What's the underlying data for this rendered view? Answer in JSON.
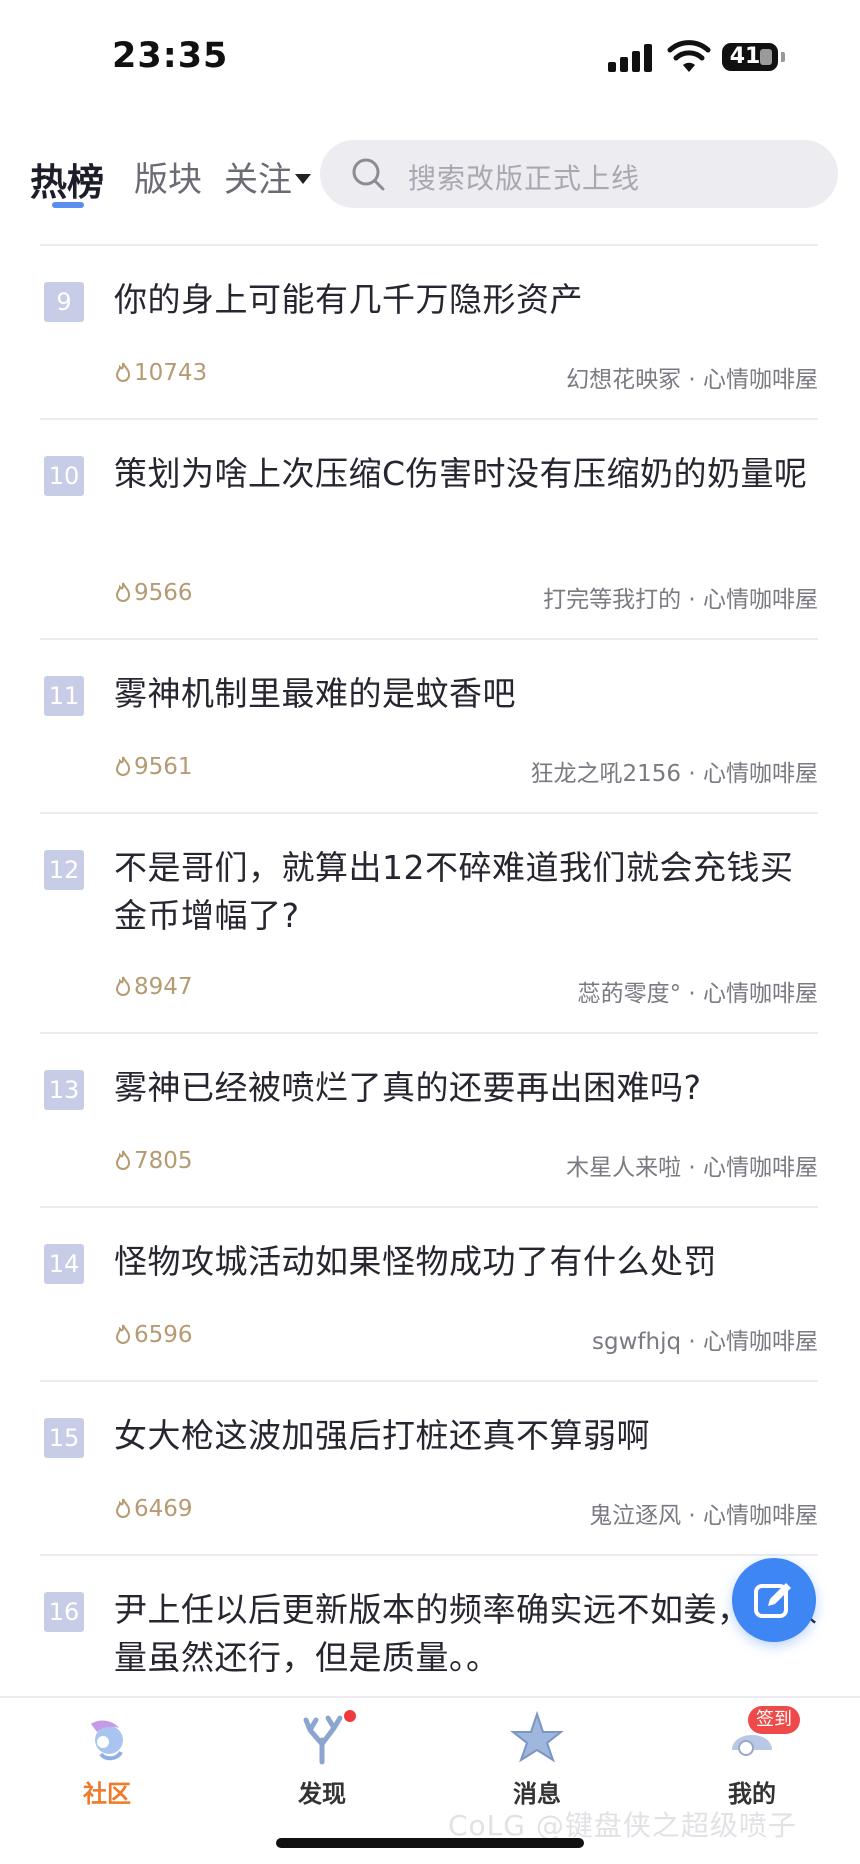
{
  "status_bar": {
    "time": "23:35",
    "battery": "41"
  },
  "header": {
    "tabs": [
      {
        "label": "热榜"
      },
      {
        "label": "版块"
      },
      {
        "label": "关注"
      }
    ],
    "search": {
      "placeholder": "搜索改版正式上线"
    }
  },
  "posts": [
    {
      "rank": "9",
      "title": "你的身上可能有几千万隐形资产",
      "heat": "10743",
      "meta": "幻想花映冢 · 心情咖啡屋"
    },
    {
      "rank": "10",
      "title": "策划为啥上次压缩C伤害时没有压缩奶的奶量呢",
      "heat": "9566",
      "meta": "打完等我打的 · 心情咖啡屋"
    },
    {
      "rank": "11",
      "title": "雾神机制里最难的是蚊香吧",
      "heat": "9561",
      "meta": "狂龙之吼2156 · 心情咖啡屋"
    },
    {
      "rank": "12",
      "title": "不是哥们，就算出12不碎难道我们就会充钱买金币增幅了?",
      "heat": "8947",
      "meta": "蕊菂零度° · 心情咖啡屋"
    },
    {
      "rank": "13",
      "title": "雾神已经被喷烂了真的还要再出困难吗?",
      "heat": "7805",
      "meta": "木星人来啦 · 心情咖啡屋"
    },
    {
      "rank": "14",
      "title": "怪物攻城活动如果怪物成功了有什么处罚",
      "heat": "6596",
      "meta": "sgwfhjq · 心情咖啡屋"
    },
    {
      "rank": "15",
      "title": "女大枪这波加强后打桩还真不算弱啊",
      "heat": "6469",
      "meta": "鬼泣逐风 · 心情咖啡屋"
    },
    {
      "rank": "16",
      "title": "尹上任以后更新版本的频率确实远不如姜，畜数量虽然还行，但是质量。。",
      "heat": "",
      "meta": ""
    }
  ],
  "bottom_nav": [
    {
      "label": "社区",
      "active": true
    },
    {
      "label": "发现"
    },
    {
      "label": "消息"
    },
    {
      "label": "我的",
      "badge": "签到"
    }
  ],
  "watermark": "CoLG @键盘侠之超级喷子",
  "colors": {
    "accent_blue": "#3f86f5",
    "active_orange": "#f07a2b",
    "rank_bg": "#c7cce7",
    "heat": "#b69a72"
  }
}
